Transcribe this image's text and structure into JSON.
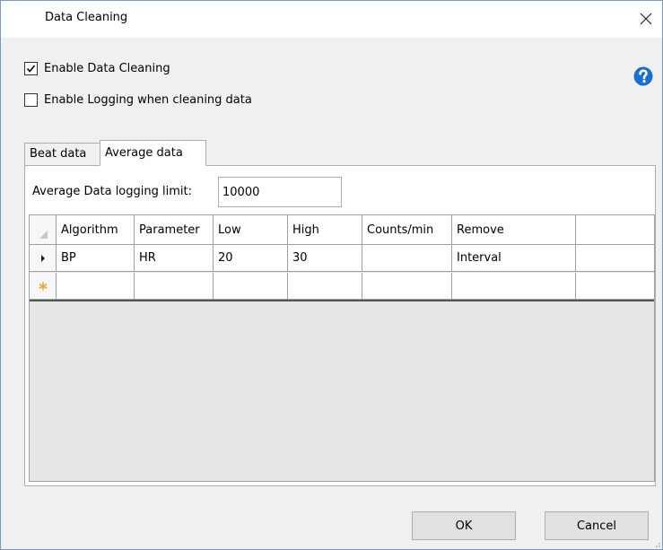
{
  "window": {
    "title": "Data Cleaning"
  },
  "options": {
    "enable_cleaning": {
      "label": "Enable Data Cleaning",
      "checked": true
    },
    "enable_logging": {
      "label": "Enable Logging when cleaning data",
      "checked": false
    }
  },
  "tabs": [
    {
      "label": "Beat data",
      "active": false
    },
    {
      "label": "Average data",
      "active": true
    }
  ],
  "average": {
    "limit_label": "Average Data logging limit:",
    "limit_value": "10000"
  },
  "grid": {
    "columns": [
      "Algorithm",
      "Parameter",
      "Low",
      "High",
      "Counts/min",
      "Remove"
    ],
    "rows": [
      [
        "BP",
        "HR",
        "20",
        "30",
        "",
        "Interval"
      ]
    ]
  },
  "buttons": {
    "ok": "OK",
    "cancel": "Cancel"
  },
  "colors": {
    "help_icon": "#1a6fd0",
    "new_row_marker": "#e8a33d"
  }
}
